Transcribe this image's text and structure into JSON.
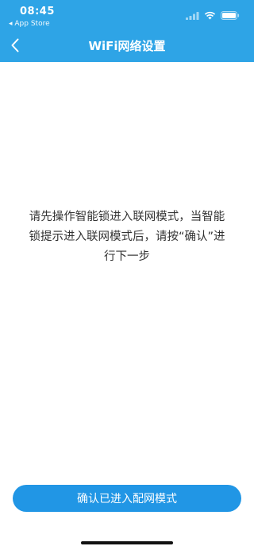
{
  "status_bar": {
    "time": "08:45",
    "back_app_label": "◂ App Store",
    "icons": [
      "signal-icon",
      "wifi-icon",
      "battery-icon"
    ]
  },
  "nav": {
    "back_icon": "chevron-left-icon",
    "title": "WiFi网络设置"
  },
  "main": {
    "instruction_text": "请先操作智能锁进入联网模式，当智能锁提示进入联网模式后，请按“确认”进行下一步"
  },
  "footer": {
    "confirm_label": "确认已进入配网模式"
  },
  "colors": {
    "header_bg": "#2ea4e6",
    "button_bg": "#2196e5",
    "text": "#333333"
  }
}
